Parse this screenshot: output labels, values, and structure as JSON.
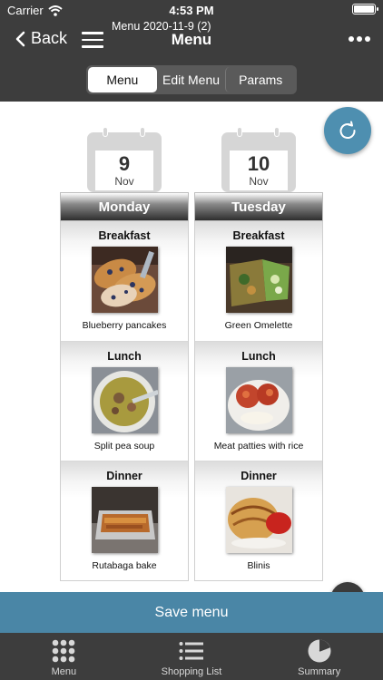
{
  "status_bar": {
    "carrier": "Carrier",
    "time": "4:53 PM"
  },
  "nav": {
    "back_label": "Back",
    "subtitle": "Menu 2020-11-9 (2)",
    "title": "Menu"
  },
  "segments": [
    {
      "label": "Menu",
      "selected": true
    },
    {
      "label": "Edit Menu",
      "selected": false
    },
    {
      "label": "Params",
      "selected": false
    }
  ],
  "days": [
    {
      "day_number": "9",
      "month": "Nov",
      "weekday": "Monday",
      "meals": [
        {
          "meal": "Breakfast",
          "dish": "Blueberry pancakes"
        },
        {
          "meal": "Lunch",
          "dish": "Split pea soup"
        },
        {
          "meal": "Dinner",
          "dish": "Rutabaga bake"
        }
      ]
    },
    {
      "day_number": "10",
      "month": "Nov",
      "weekday": "Tuesday",
      "meals": [
        {
          "meal": "Breakfast",
          "dish": "Green Omelette"
        },
        {
          "meal": "Lunch",
          "dish": "Meat patties with rice"
        },
        {
          "meal": "Dinner",
          "dish": "Blinis"
        }
      ]
    }
  ],
  "save_label": "Save menu",
  "tabs": [
    {
      "label": "Menu",
      "icon": "grid-icon"
    },
    {
      "label": "Shopping List",
      "icon": "list-icon"
    },
    {
      "label": "Summary",
      "icon": "pie-chart-icon"
    }
  ],
  "colors": {
    "bar_background": "#3d3d3d",
    "accent_blue": "#4a86a6",
    "refresh_button": "#4e8fb0"
  }
}
